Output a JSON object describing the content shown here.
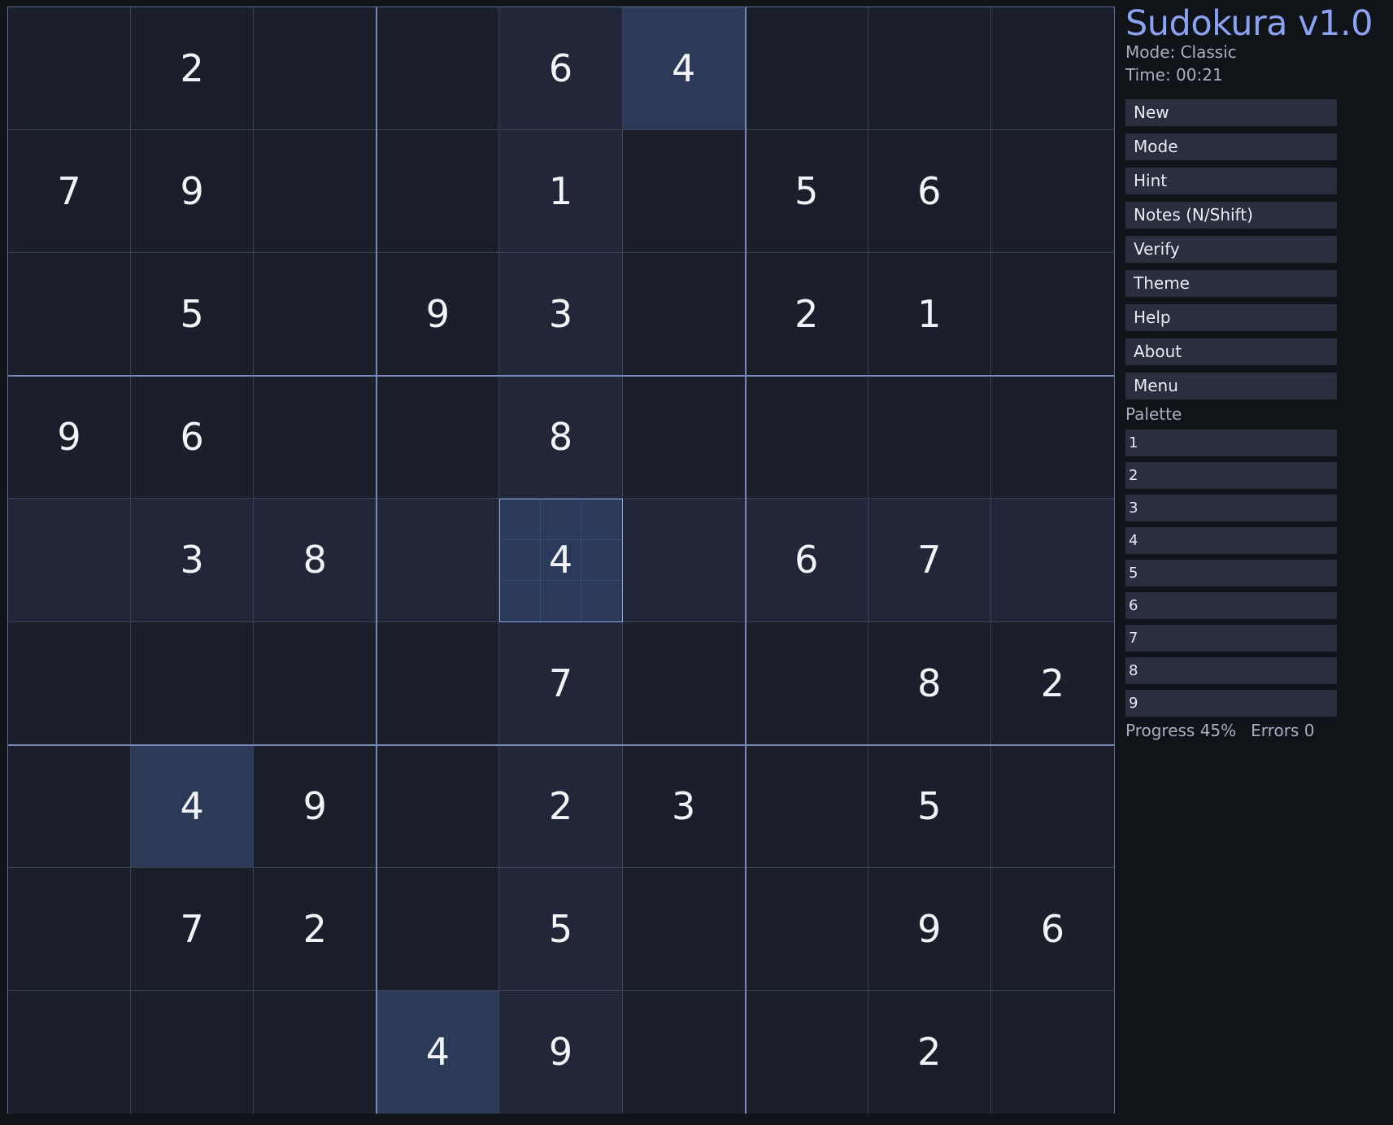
{
  "app": {
    "title": "Sudokura v1.0",
    "mode_text": "Mode: Classic",
    "time_text": "Time: 00:21"
  },
  "menu": [
    {
      "label": "New",
      "name": "new-button"
    },
    {
      "label": "Mode",
      "name": "mode-button"
    },
    {
      "label": "Hint",
      "name": "hint-button"
    },
    {
      "label": "Notes (N/Shift)",
      "name": "notes-button"
    },
    {
      "label": "Verify",
      "name": "verify-button"
    },
    {
      "label": "Theme",
      "name": "theme-button"
    },
    {
      "label": "Help",
      "name": "help-button"
    },
    {
      "label": "About",
      "name": "about-button"
    },
    {
      "label": "Menu",
      "name": "menu-button"
    }
  ],
  "palette": {
    "label": "Palette",
    "digits": [
      "1",
      "2",
      "3",
      "4",
      "5",
      "6",
      "7",
      "8",
      "9"
    ]
  },
  "status": {
    "progress_text": "Progress 45%",
    "errors_text": "Errors 0",
    "progress_value": 0.45,
    "errors": 0
  },
  "board": {
    "grid": [
      [
        "",
        "2",
        "",
        "",
        "6",
        "4",
        "",
        "",
        ""
      ],
      [
        "7",
        "9",
        "",
        "",
        "1",
        "",
        "5",
        "6",
        ""
      ],
      [
        "",
        "5",
        "",
        "9",
        "3",
        "",
        "2",
        "1",
        ""
      ],
      [
        "9",
        "6",
        "",
        "",
        "8",
        "",
        "",
        "",
        ""
      ],
      [
        "",
        "3",
        "8",
        "",
        "4",
        "",
        "6",
        "7",
        ""
      ],
      [
        "",
        "",
        "",
        "",
        "7",
        "",
        "",
        "8",
        "2"
      ],
      [
        "",
        "4",
        "9",
        "",
        "2",
        "3",
        "",
        "5",
        ""
      ],
      [
        "",
        "7",
        "2",
        "",
        "5",
        "",
        "",
        "9",
        "6"
      ],
      [
        "",
        "",
        "",
        "4",
        "9",
        "",
        "",
        "2",
        ""
      ]
    ],
    "selected": {
      "row": 4,
      "col": 4
    },
    "notes_grid_on_selected": true
  },
  "colors": {
    "accent": "#8aa2ef",
    "cell": "#1b1f2c",
    "related": "#212738",
    "same_digit": "#2c3a58",
    "selected": "#2b3a5a",
    "button": "#2a2f40"
  }
}
